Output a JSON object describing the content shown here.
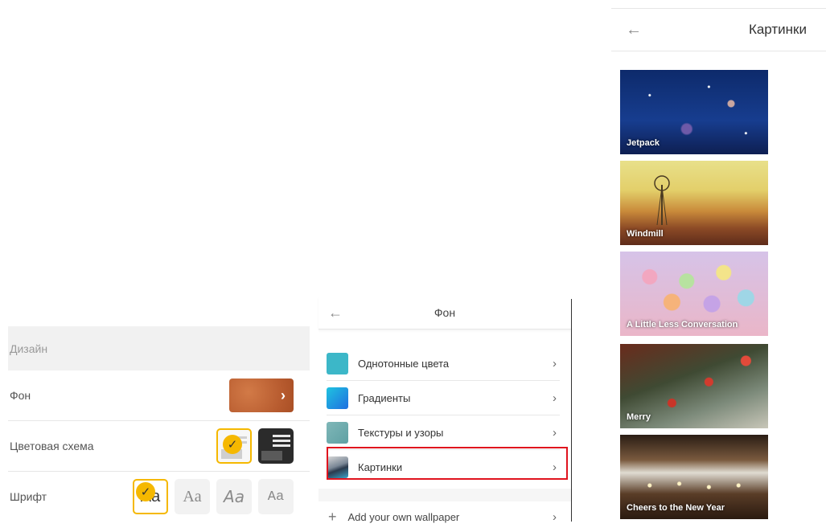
{
  "design_panel": {
    "header": "Дизайн",
    "rows": {
      "background": {
        "label": "Фон",
        "chevron": "›"
      },
      "color_scheme": {
        "label": "Цветовая схема",
        "check": "✓"
      },
      "font": {
        "label": "Шрифт",
        "options": [
          "Aa",
          "Aa",
          "Aa",
          "Aa"
        ],
        "selected_index": 0,
        "check": "✓"
      }
    }
  },
  "background_panel": {
    "back_icon": "←",
    "title": "Фон",
    "items": [
      {
        "label": "Однотонные цвета",
        "icon": "solid-color-thumb",
        "chevron": "›"
      },
      {
        "label": "Градиенты",
        "icon": "gradient-thumb",
        "chevron": "›"
      },
      {
        "label": "Текстуры и узоры",
        "icon": "texture-thumb",
        "chevron": "›"
      },
      {
        "label": "Картинки",
        "icon": "picture-thumb",
        "chevron": "›",
        "highlighted": true
      }
    ],
    "add": {
      "plus": "+",
      "label": "Add your own wallpaper",
      "chevron": "›"
    },
    "highlight_color": "#e0141e"
  },
  "pictures_panel": {
    "back_icon": "←",
    "title": "Картинки",
    "pictures": [
      {
        "label": "Jetpack"
      },
      {
        "label": "Windmill"
      },
      {
        "label": "A Little Less Conversation"
      },
      {
        "label": "Merry"
      },
      {
        "label": "Cheers to the New Year"
      }
    ]
  },
  "colors": {
    "accent": "#f5b800",
    "background_swatch": "#c0663a"
  }
}
